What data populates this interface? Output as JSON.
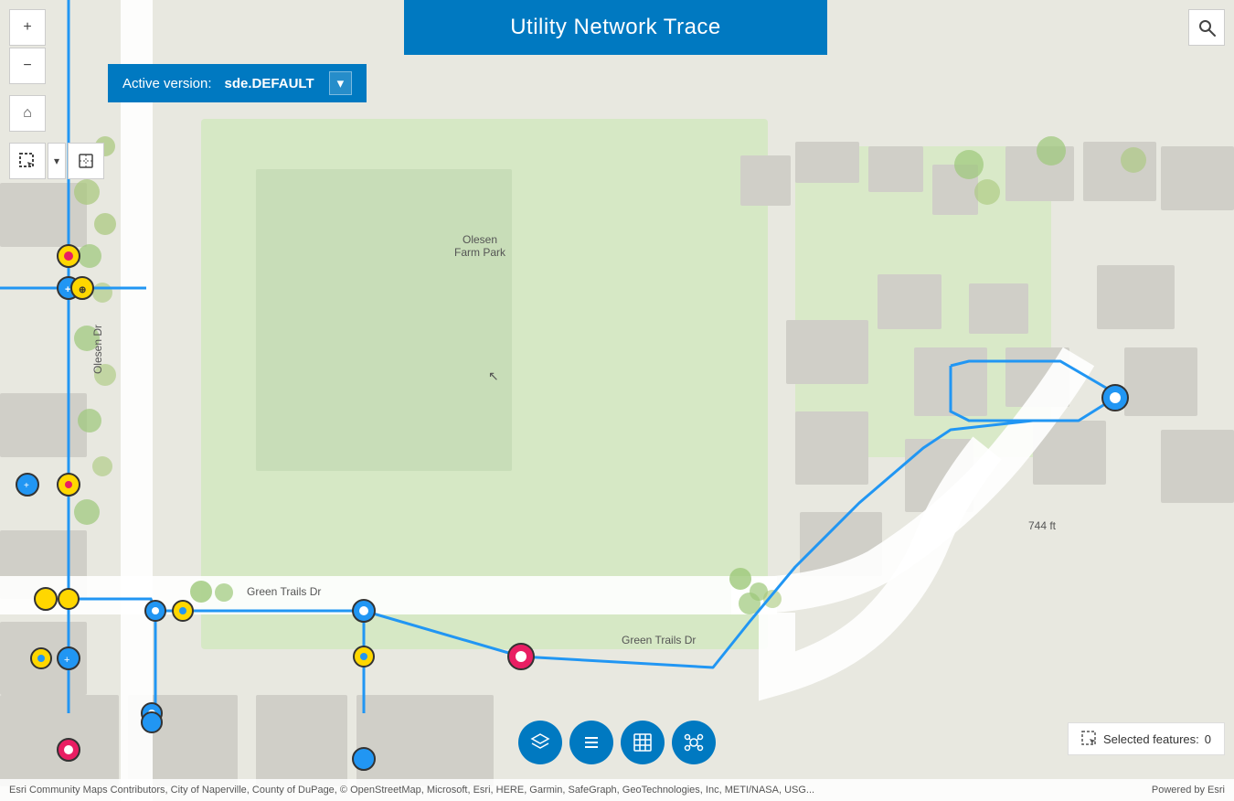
{
  "header": {
    "title": "Utility Network Trace"
  },
  "toolbar": {
    "zoom_in": "+",
    "zoom_out": "−",
    "home": "⌂",
    "select": "▣",
    "select_label": "▣",
    "snap": "⊡"
  },
  "version": {
    "label": "Active version:",
    "value": "sde.DEFAULT",
    "dropdown_arrow": "▾"
  },
  "bottom_toolbar": {
    "layers_icon": "☰",
    "list_icon": "≡",
    "table_icon": "⊞",
    "network_icon": "⬡"
  },
  "selected_features": {
    "icon": "⊟",
    "label": "Selected features:",
    "count": "0"
  },
  "attribution": {
    "left": "Esri Community Maps Contributors, City of Naperville, County of DuPage, © OpenStreetMap, Microsoft, Esri, HERE, Garmin, SafeGraph, GeoTechnologies, Inc, METI/NASA, USG...",
    "right": "Powered by Esri"
  },
  "map": {
    "park_name_line1": "Olesen",
    "park_name_line2": "Farm Park",
    "road_label1": "Olesen Dr",
    "road_label2": "Green Trails Dr",
    "road_label3": "Green Trails Dr",
    "dist_label": "744 ft"
  },
  "search": {
    "icon": "🔍"
  }
}
